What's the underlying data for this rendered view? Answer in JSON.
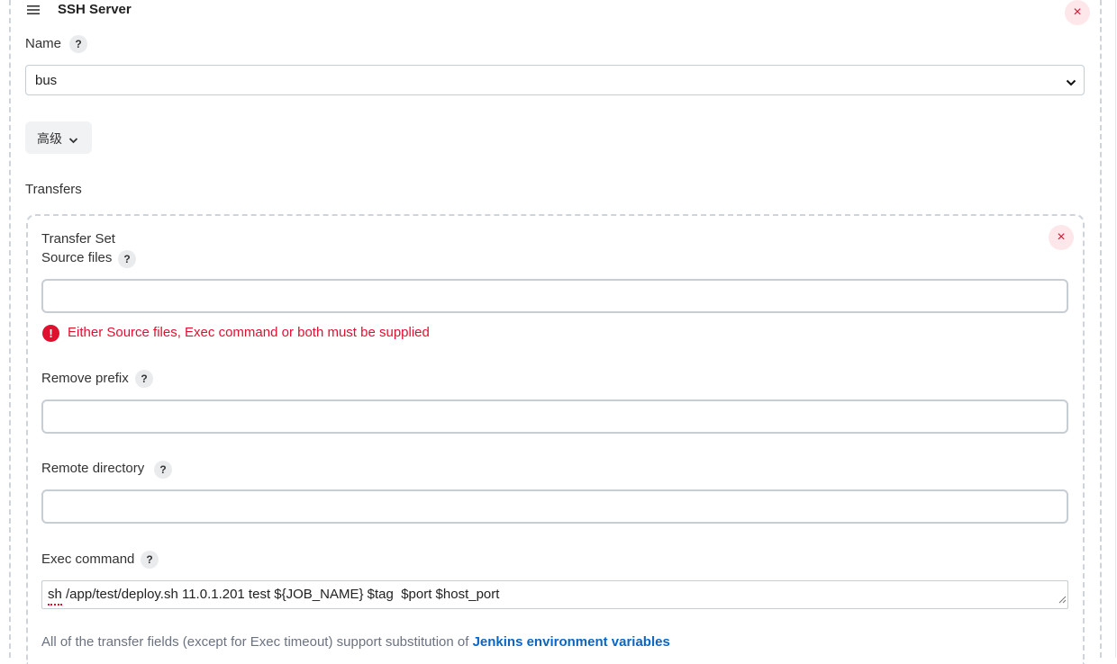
{
  "server": {
    "title": "SSH Server",
    "name_label": "Name",
    "name_help": "?",
    "name_value": "bus",
    "advanced_label": "高级",
    "close_symbol": "×"
  },
  "transfers": {
    "label": "Transfers",
    "set_title": "Transfer Set",
    "source_label": "Source files",
    "source_value": "",
    "error_icon": "!",
    "error_text": "Either Source files, Exec command or both must be supplied",
    "remove_prefix_label": "Remove prefix",
    "remove_prefix_value": "",
    "remote_dir_label": "Remote directory",
    "remote_dir_value": "",
    "exec_label": "Exec command",
    "exec_value": "sh /app/test/deploy.sh 11.0.1.201 test ${JOB_NAME} $tag  $port $host_port",
    "help": "?",
    "close_symbol": "×",
    "footer_prefix": "All of the transfer fields (except for Exec timeout) support substitution of ",
    "footer_link": "Jenkins environment variables"
  },
  "colors": {
    "error": "#e0102f",
    "link": "#0b66c3",
    "muted": "#6b7280"
  }
}
